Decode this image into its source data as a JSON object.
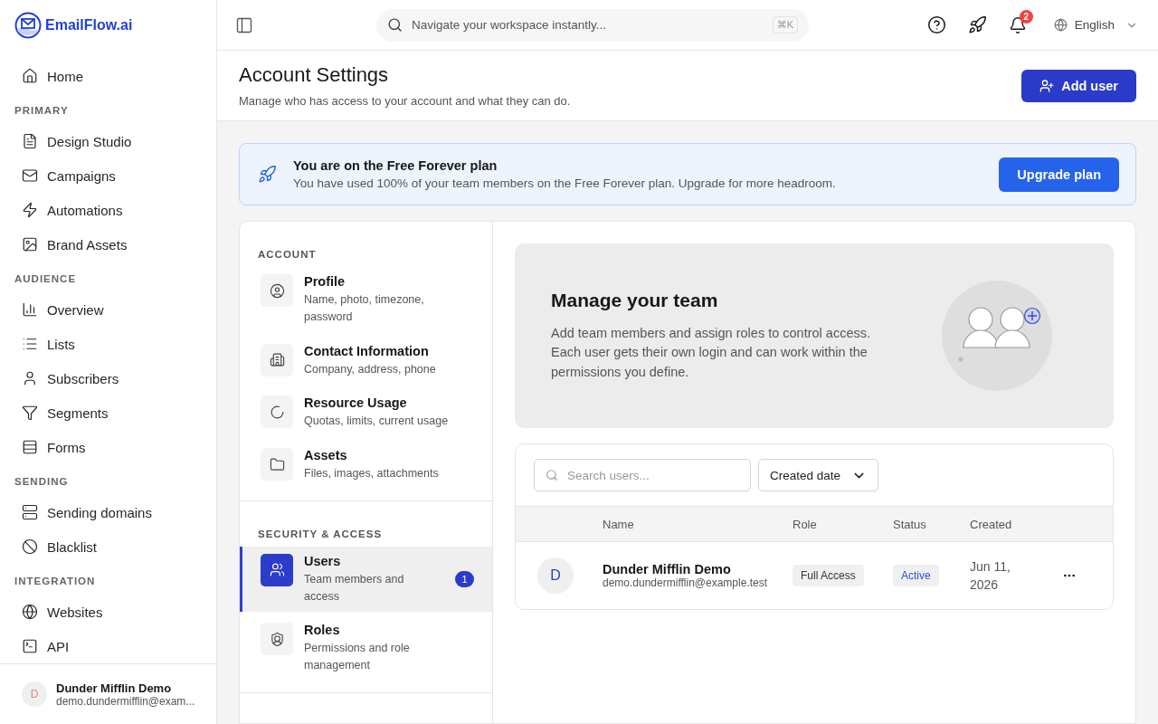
{
  "brand": "EmailFlow.ai",
  "sidebar": {
    "items": [
      {
        "label": "Home"
      }
    ],
    "sections": [
      {
        "heading": "PRIMARY",
        "items": [
          {
            "label": "Design Studio"
          },
          {
            "label": "Campaigns"
          },
          {
            "label": "Automations"
          },
          {
            "label": "Brand Assets"
          }
        ]
      },
      {
        "heading": "AUDIENCE",
        "items": [
          {
            "label": "Overview"
          },
          {
            "label": "Lists"
          },
          {
            "label": "Subscribers"
          },
          {
            "label": "Segments"
          },
          {
            "label": "Forms"
          }
        ]
      },
      {
        "heading": "SENDING",
        "items": [
          {
            "label": "Sending domains"
          },
          {
            "label": "Blacklist"
          }
        ]
      },
      {
        "heading": "INTEGRATION",
        "items": [
          {
            "label": "Websites"
          },
          {
            "label": "API"
          }
        ]
      }
    ],
    "user": {
      "initial": "D",
      "name": "Dunder Mifflin Demo",
      "email": "demo.dundermifflin@exam..."
    }
  },
  "topbar": {
    "search_placeholder": "Navigate your workspace instantly...",
    "shortcut": "⌘K",
    "notifications": "2",
    "language": "English"
  },
  "header": {
    "title": "Account Settings",
    "subtitle": "Manage who has access to your account and what they can do.",
    "button": "Add user"
  },
  "banner": {
    "title": "You are on the Free Forever plan",
    "text": "You have used 100% of your team members on the Free Forever plan. Upgrade for more headroom.",
    "button": "Upgrade plan"
  },
  "settings_nav": [
    {
      "heading": "ACCOUNT",
      "items": [
        {
          "title": "Profile",
          "description": "Name, photo, timezone, password",
          "selected": false
        },
        {
          "title": "Contact Information",
          "description": "Company, address, phone",
          "selected": false
        },
        {
          "title": "Resource Usage",
          "description": "Quotas, limits, current usage",
          "selected": false
        },
        {
          "title": "Assets",
          "description": "Files, images, attachments",
          "selected": false
        }
      ]
    },
    {
      "heading": "SECURITY & ACCESS",
      "items": [
        {
          "title": "Users",
          "description": "Team members and access",
          "selected": true,
          "badge": "1"
        },
        {
          "title": "Roles",
          "description": "Permissions and role management",
          "selected": false
        }
      ]
    }
  ],
  "team": {
    "title": "Manage your team",
    "text": "Add team members and assign roles to control access. Each user gets their own login and can work within the permissions you define."
  },
  "users": {
    "search_placeholder": "Search users...",
    "sort": "Created date",
    "columns": [
      "Name",
      "Role",
      "Status",
      "Created"
    ],
    "rows": [
      {
        "initial": "D",
        "name": "Dunder Mifflin Demo",
        "email": "demo.dundermifflin@example.test",
        "role": "Full Access",
        "status": "Active",
        "created": "Jun 11, 2026"
      }
    ]
  }
}
